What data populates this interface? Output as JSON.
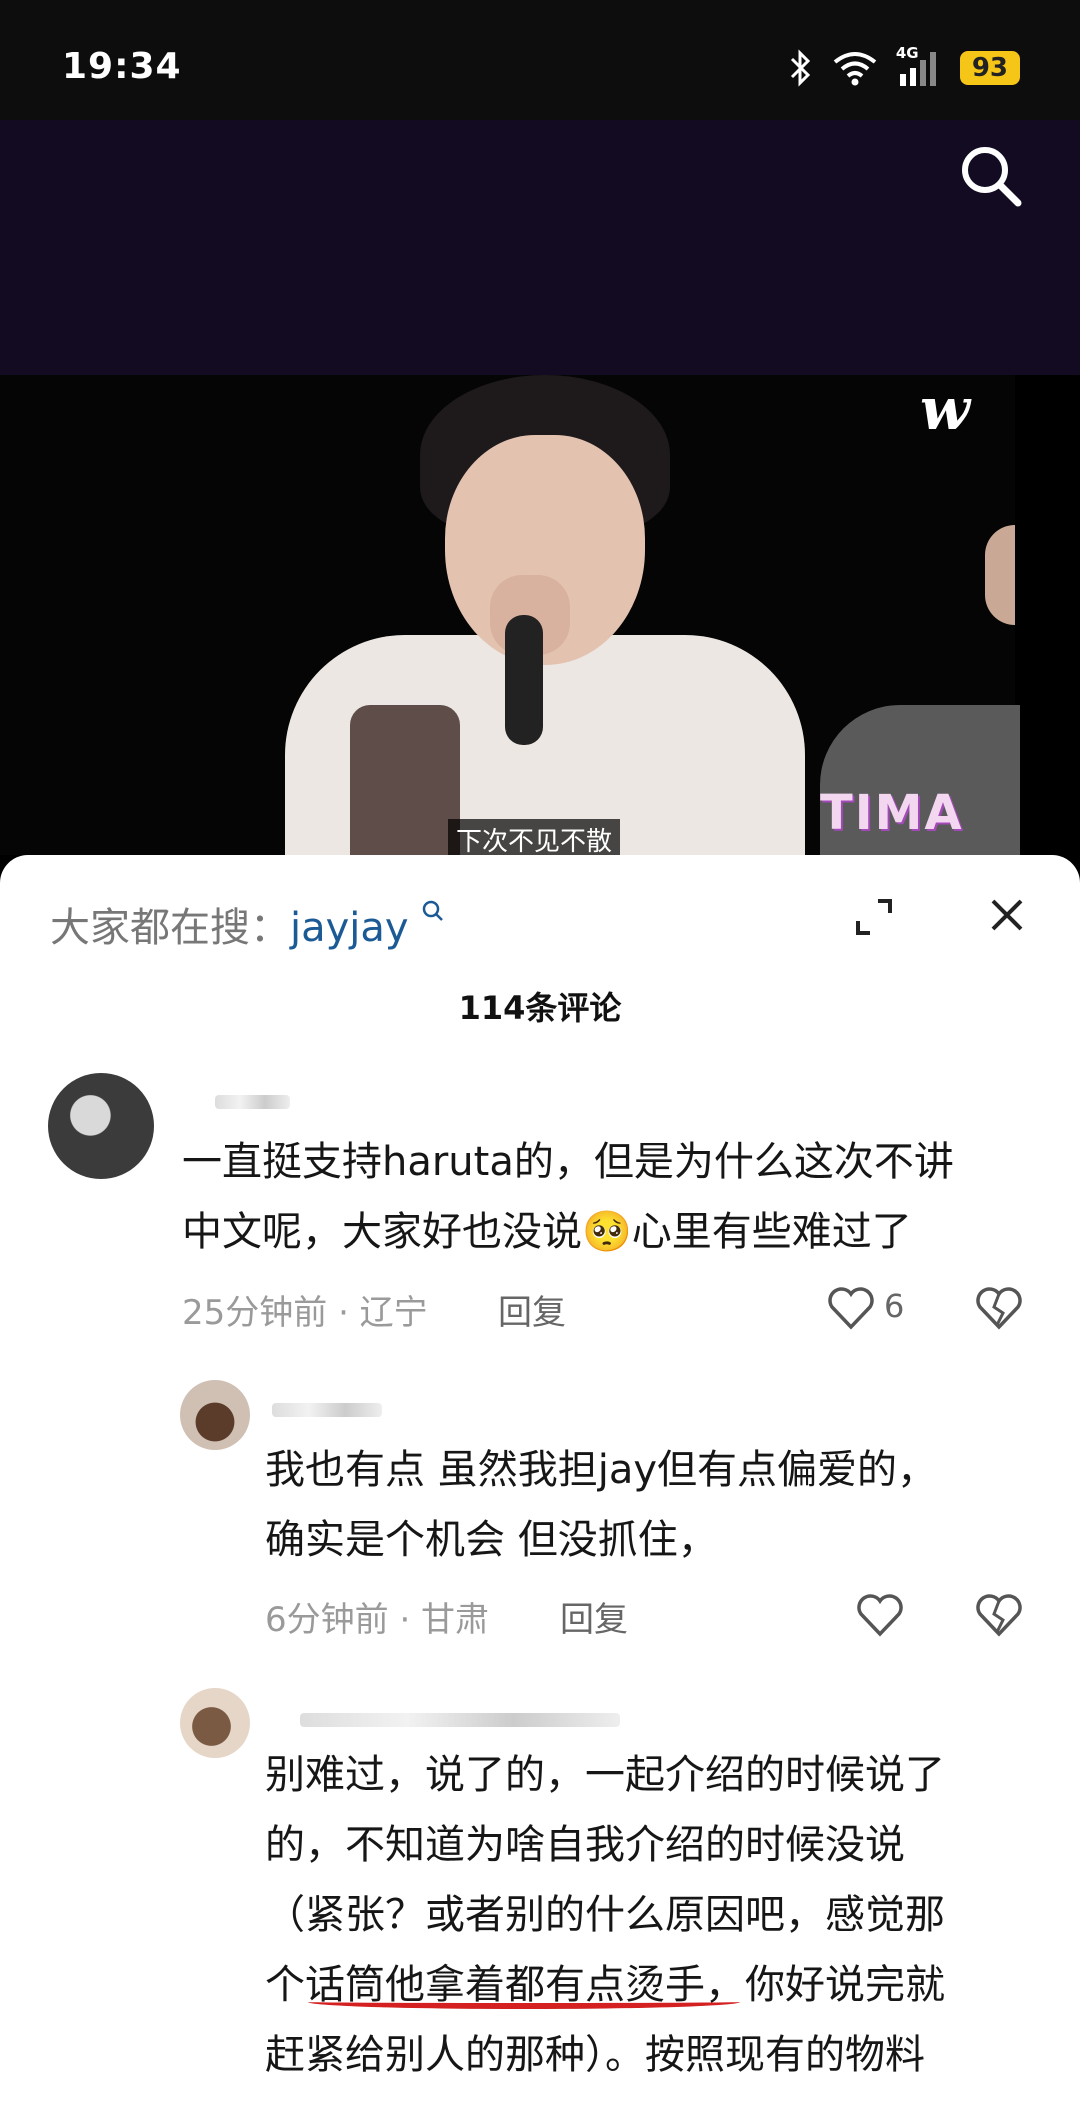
{
  "status_bar": {
    "time": "19:34",
    "network": "4G",
    "battery": "93"
  },
  "video": {
    "subtitle": "下次不见不散",
    "watermark": "w",
    "stage_logo": "TIMA"
  },
  "sheet": {
    "search_hint_prefix": "大家都在搜：",
    "search_hint_term": "jayjay",
    "comment_count": "114条评论"
  },
  "comments": [
    {
      "text_line1": "一直挺支持haruta的，但是为什么这次不讲",
      "text_line2": "中文呢，大家好也没说🥺心里有些难过了",
      "meta": "25分钟前 · 辽宁",
      "reply": "回复",
      "likes": "6"
    },
    {
      "text_line1": "我也有点 虽然我担jay但有点偏爱的，",
      "text_line2": "确实是个机会 但没抓住，",
      "meta": "6分钟前 · 甘肃",
      "reply": "回复"
    },
    {
      "line1": "别难过，说了的，一起介绍的时候说了",
      "line2": "的，不知道为啥自我介绍的时候没说",
      "line3": "（紧张？或者别的什么原因吧，感觉那",
      "line4": "个话筒他拿着都有点烫手，你好说完就",
      "line5": "赶紧给别人的那种）。按照现有的物料"
    }
  ],
  "colors": {
    "accent_link": "#1c5a96",
    "underline": "#d42020",
    "battery": "#f5c518"
  },
  "icons": [
    "bluetooth-icon",
    "wifi-icon",
    "signal-icon",
    "search-icon",
    "expand-icon",
    "close-icon",
    "heart-icon",
    "dislike-icon",
    "search-small-icon"
  ]
}
